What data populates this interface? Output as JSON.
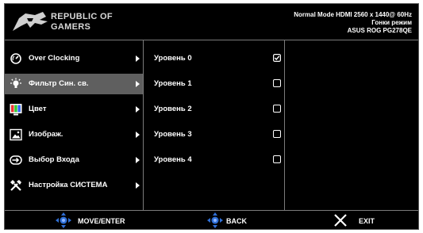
{
  "header": {
    "brand_line1": "REPUBLIC OF",
    "brand_line2": "GAMERS",
    "status_line1": "Normal Mode HDMI 2560 x 1440@ 60Hz",
    "status_line2": "Гонки режим",
    "status_line3": "ASUS ROG PG278QE"
  },
  "menu": {
    "items": [
      {
        "label": "Over Clocking",
        "icon": "gauge-icon"
      },
      {
        "label": "Фильтр Син. св.",
        "icon": "bulb-icon",
        "selected": true
      },
      {
        "label": "Цвет",
        "icon": "color-bars-icon"
      },
      {
        "label": "Изображ.",
        "icon": "image-icon"
      },
      {
        "label": "Выбор Входа",
        "icon": "input-icon"
      },
      {
        "label": "Настройка СИСТЕМА",
        "icon": "tools-icon"
      }
    ]
  },
  "submenu": {
    "options": [
      {
        "label": "Уровень 0",
        "checked": true
      },
      {
        "label": "Уровень 1",
        "checked": false
      },
      {
        "label": "Уровень 2",
        "checked": false
      },
      {
        "label": "Уровень 3",
        "checked": false
      },
      {
        "label": "Уровень 4",
        "checked": false
      }
    ]
  },
  "footer": {
    "move_label": "MOVE/ENTER",
    "back_label": "BACK",
    "exit_label": "EXIT"
  },
  "colors": {
    "background": "#000000",
    "selected_row": "#5f5f5f",
    "dpad_blue": "#2f6fd6",
    "divider": "#7a7a7a"
  }
}
